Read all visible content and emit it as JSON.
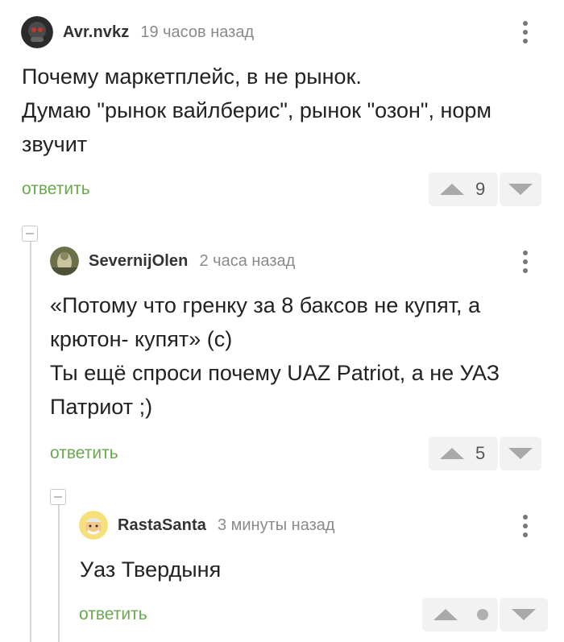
{
  "comments": [
    {
      "author": "Avr.nvkz",
      "time": "19 часов назад",
      "lines": [
        "Почему маркетплейс, в не рынок.",
        "Думаю \"рынок вайлберис\", рынок \"озон\", норм",
        "звучит"
      ],
      "reply_label": "ответить",
      "score": "9"
    },
    {
      "author": "SevernijOlen",
      "time": "2 часа назад",
      "lines": [
        "«Потому что гренку за 8 баксов не купят, а",
        "крютон- купят» (с)",
        "Ты ещё спроси почему UAZ Patriot, а не УАЗ",
        "Патриот ;)"
      ],
      "reply_label": "ответить",
      "score": "5"
    },
    {
      "author": "RastaSanta",
      "time": "3 минуты назад",
      "lines": [
        "Уаз Твердыня"
      ],
      "reply_label": "ответить",
      "score": ""
    }
  ],
  "colors": {
    "reply": "#6aa84f",
    "vote_bg": "#f2f2f2",
    "arrow": "#a9a9a9"
  },
  "icons": [
    "more-vertical-icon",
    "vote-up-icon",
    "vote-down-icon",
    "collapse-thread-icon"
  ]
}
